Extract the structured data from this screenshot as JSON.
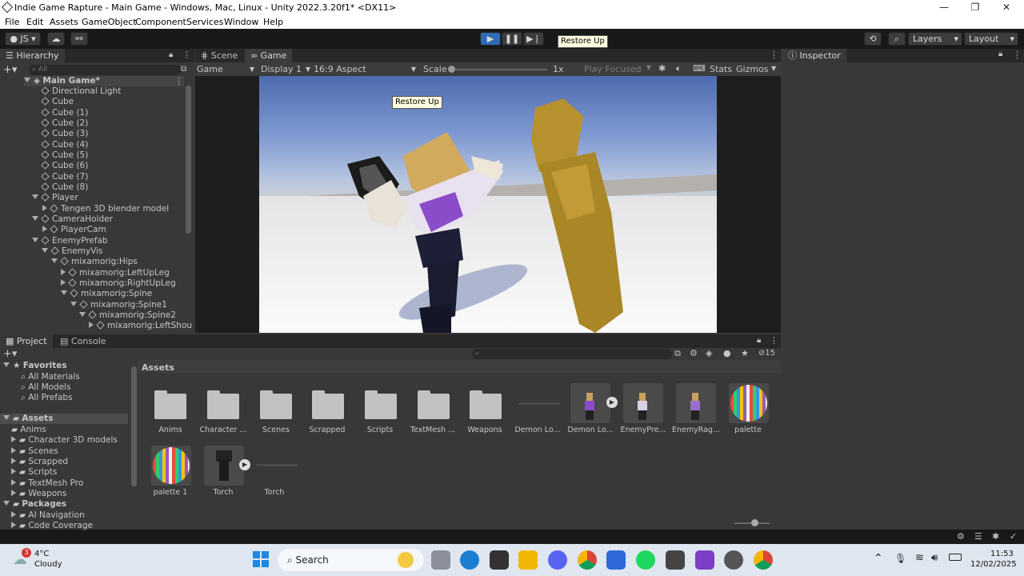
{
  "window": {
    "title": "Indie Game Rapture - Main Game - Windows, Mac, Linux - Unity 2022.3.20f1* <DX11>",
    "minimize": "—",
    "maximize": "❐",
    "close": "✕"
  },
  "menu": [
    "File",
    "Edit",
    "Assets",
    "GameObject",
    "Component",
    "Services",
    "Window",
    "Help"
  ],
  "toolbar": {
    "account": "JS",
    "layers": "Layers",
    "layout": "Layout",
    "tooltip": "Restore Up"
  },
  "hierarchy": {
    "tab": "Hierarchy",
    "search_placeholder": "All",
    "scene": "Main Game*",
    "items": [
      "Directional Light",
      "Cube",
      "Cube (1)",
      "Cube (2)",
      "Cube (3)",
      "Cube (4)",
      "Cube (5)",
      "Cube (6)",
      "Cube (7)",
      "Cube (8)",
      "Player",
      "Tengen 3D blender model",
      "CameraHolder",
      "PlayerCam",
      "EnemyPrefab",
      "EnemyVis",
      "mixamorig:Hips",
      "mixamorig:LeftUpLeg",
      "mixamorig:RightUpLeg",
      "mixamorig:Spine",
      "mixamorig:Spine1",
      "mixamorig:Spine2",
      "mixamorig:LeftShou"
    ]
  },
  "game": {
    "tabs": [
      "Scene",
      "Game"
    ],
    "display_mode": "Game",
    "display": "Display 1",
    "aspect": "16:9 Aspect",
    "scale_label": "Scale",
    "scale_value": "1x",
    "play_focused": "Play Focused",
    "stats": "Stats",
    "gizmos": "Gizmos",
    "tooltip": "Restore Up"
  },
  "inspector": {
    "tab": "Inspector"
  },
  "project": {
    "tabs": [
      "Project",
      "Console"
    ],
    "count": "15",
    "breadcrumb": "Assets",
    "tree": {
      "favorites": "Favorites",
      "fav_items": [
        "All Materials",
        "All Models",
        "All Prefabs"
      ],
      "assets": "Assets",
      "asset_items": [
        "Anims",
        "Character 3D models",
        "Scenes",
        "Scrapped",
        "Scripts",
        "TextMesh Pro",
        "Weapons"
      ],
      "packages": "Packages",
      "package_items": [
        "AI Navigation",
        "Code Coverage"
      ]
    },
    "grid": [
      "Anims",
      "Character ...",
      "Scenes",
      "Scrapped",
      "Scripts",
      "TextMesh ...",
      "Weapons",
      "Demon Lo...",
      "Demon Lo...",
      "EnemyPre...",
      "EnemyRag...",
      "palette",
      "palette 1",
      "Torch",
      "Torch"
    ]
  },
  "taskbar": {
    "temp": "4°C",
    "weather": "Cloudy",
    "badge": "3",
    "search": "Search",
    "time": "11:53",
    "date": "12/02/2025"
  }
}
